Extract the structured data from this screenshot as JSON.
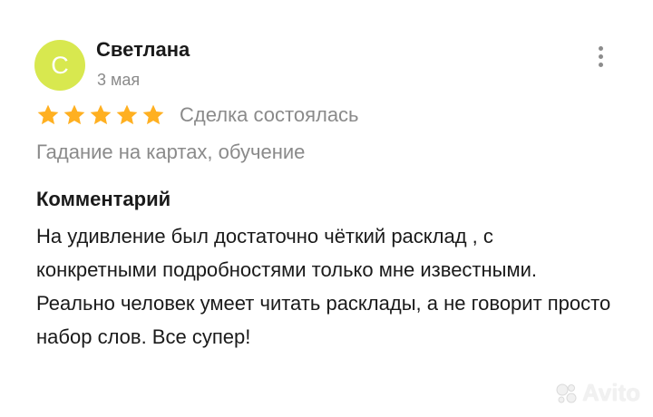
{
  "review": {
    "avatar_letter": "С",
    "avatar_color": "#d8e84f",
    "author": "Светлана",
    "date": "3 мая",
    "menu_icon": "more-vertical-icon",
    "rating": 5,
    "rating_max": 5,
    "star_color": "#ffb021",
    "deal_status": "Сделка состоялась",
    "item": "Гадание на картах, обучение",
    "comment_title": "Комментарий",
    "comment_text": "На удивление был достаточно чёткий расклад , с конкретными подробностями только мне известными. Реально человек умеет читать расклады, а не говорит просто набор слов. Все супер!"
  },
  "watermark": {
    "text": "Avito",
    "icon": "avito-logo-icon"
  }
}
